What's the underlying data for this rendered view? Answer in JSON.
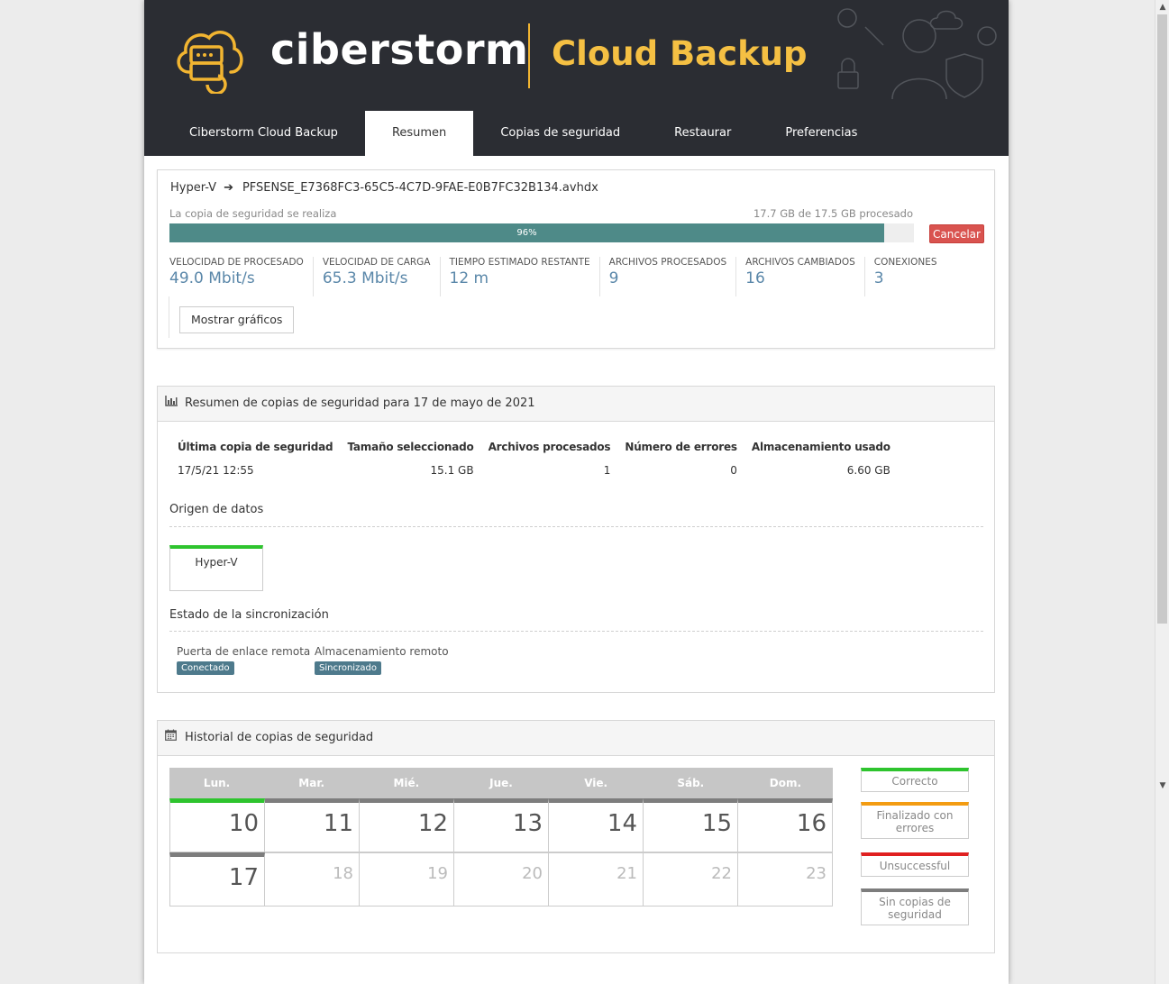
{
  "header": {
    "brand": "ciberstorm",
    "product": "Cloud Backup",
    "accent": "#f2b531"
  },
  "tabs": [
    {
      "label": "Ciberstorm Cloud Backup",
      "active": false
    },
    {
      "label": "Resumen",
      "active": true
    },
    {
      "label": "Copias de seguridad",
      "active": false
    },
    {
      "label": "Restaurar",
      "active": false
    },
    {
      "label": "Preferencias",
      "active": false
    }
  ],
  "progress": {
    "source": "Hyper-V",
    "file": "PFSENSE_E7368FC3-65C5-4C7D-9FAE-E0B7FC32B134.avhdx",
    "status": "La copia de seguridad se realiza",
    "processed": "17.7 GB de 17.5 GB procesado",
    "percent_label": "96%",
    "percent": 96,
    "cancel_label": "Cancelar",
    "stats": [
      {
        "label": "VELOCIDAD DE PROCESADO",
        "value": "49.0 Mbit/s"
      },
      {
        "label": "VELOCIDAD DE CARGA",
        "value": "65.3 Mbit/s"
      },
      {
        "label": "TIEMPO ESTIMADO RESTANTE",
        "value": "12 m"
      },
      {
        "label": "ARCHIVOS PROCESADOS",
        "value": "9"
      },
      {
        "label": "ARCHIVOS CAMBIADOS",
        "value": "16"
      },
      {
        "label": "CONEXIONES",
        "value": "3"
      }
    ],
    "graphs_button": "Mostrar gráficos"
  },
  "summary": {
    "title": "Resumen de copias de seguridad para 17 de mayo de 2021",
    "columns": [
      "Última copia de seguridad",
      "Tamaño seleccionado",
      "Archivos procesados",
      "Número de errores",
      "Almacenamiento usado"
    ],
    "row": [
      "17/5/21 12:55",
      "15.1 GB",
      "1",
      "0",
      "6.60 GB"
    ],
    "data_origin_title": "Origen de datos",
    "data_origin": "Hyper-V",
    "sync_title": "Estado de la sincronización",
    "sync": [
      {
        "label": "Puerta de enlace remota",
        "badge": "Conectado"
      },
      {
        "label": "Almacenamiento remoto",
        "badge": "Sincronizado"
      }
    ]
  },
  "history": {
    "title": "Historial de copias de seguridad",
    "days": [
      "Lun.",
      "Mar.",
      "Mié.",
      "Jue.",
      "Vie.",
      "Sáb.",
      "Dom."
    ],
    "week1": [
      "10",
      "11",
      "12",
      "13",
      "14",
      "15",
      "16"
    ],
    "week2": [
      "17",
      "18",
      "19",
      "20",
      "21",
      "22",
      "23"
    ],
    "legend": [
      {
        "label": "Correcto",
        "color": "#2ec42e"
      },
      {
        "label": "Finalizado con errores",
        "color": "#f39c12"
      },
      {
        "label": "Unsuccessful",
        "color": "#e02020"
      },
      {
        "label": "Sin copias de seguridad",
        "color": "#7d7d7d"
      }
    ]
  }
}
